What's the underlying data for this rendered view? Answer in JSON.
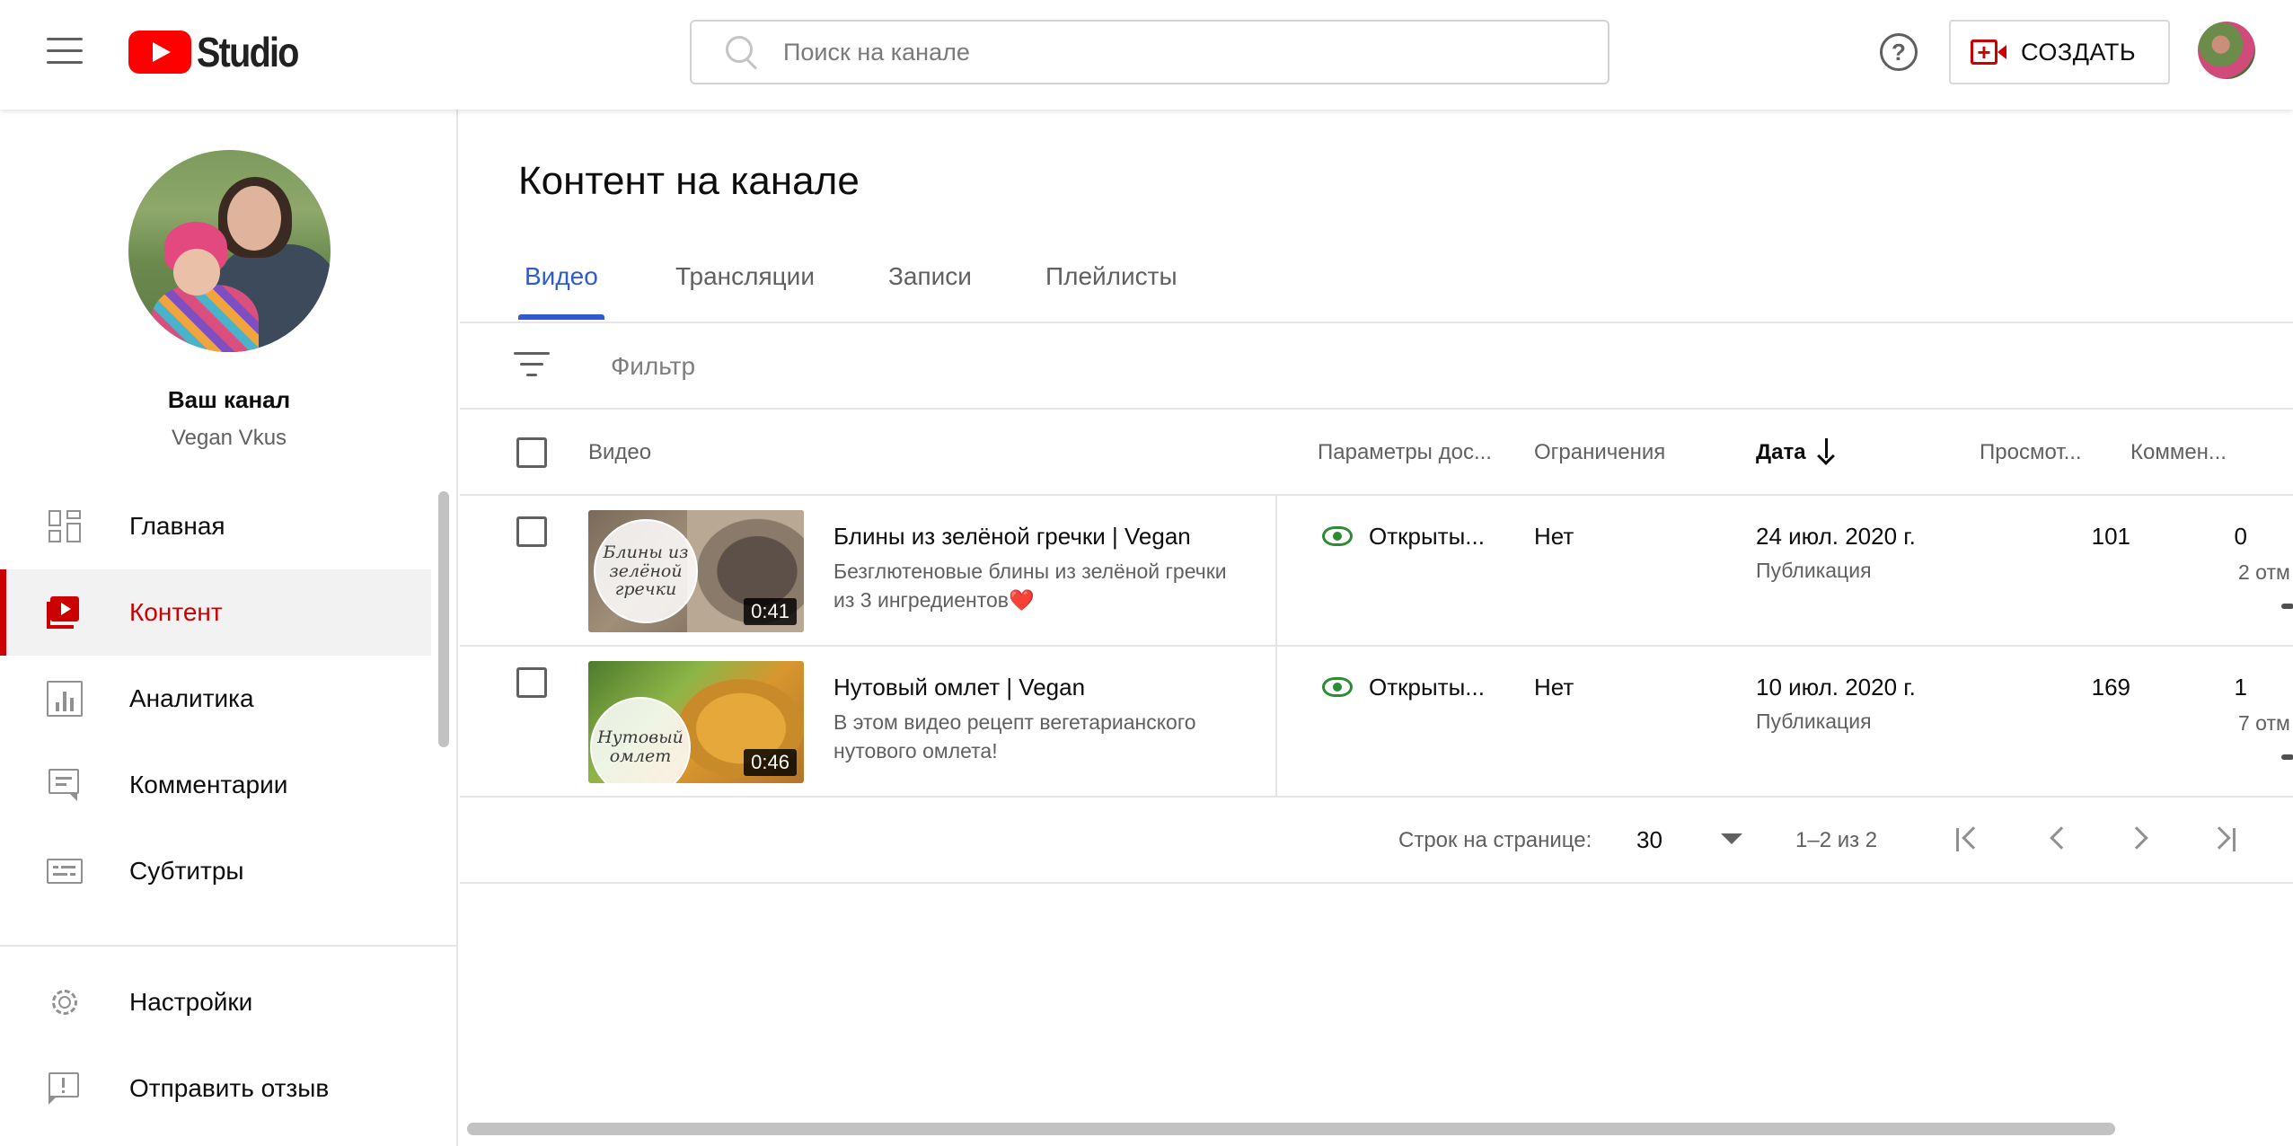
{
  "header": {
    "logo_text": "Studio",
    "search_placeholder": "Поиск на канале",
    "help_label": "?",
    "create_label": "СОЗДАТЬ"
  },
  "sidebar": {
    "channel_title": "Ваш канал",
    "channel_name": "Vegan Vkus",
    "items": [
      {
        "label": "Главная",
        "icon": "dashboard-icon",
        "active": false
      },
      {
        "label": "Контент",
        "icon": "content-icon",
        "active": true
      },
      {
        "label": "Аналитика",
        "icon": "analytics-icon",
        "active": false
      },
      {
        "label": "Комментарии",
        "icon": "comments-icon",
        "active": false
      },
      {
        "label": "Субтитры",
        "icon": "subtitles-icon",
        "active": false
      }
    ],
    "bottom_items": [
      {
        "label": "Настройки",
        "icon": "gear-icon"
      },
      {
        "label": "Отправить отзыв",
        "icon": "feedback-icon"
      }
    ]
  },
  "main": {
    "title": "Контент на канале",
    "tabs": [
      {
        "label": "Видео",
        "active": true
      },
      {
        "label": "Трансляции",
        "active": false
      },
      {
        "label": "Записи",
        "active": false
      },
      {
        "label": "Плейлисты",
        "active": false
      }
    ],
    "filter_placeholder": "Фильтр",
    "columns": [
      "Видео",
      "Параметры дос...",
      "Ограничения",
      "Дата",
      "Просмот...",
      "Коммен..."
    ],
    "sort_column": "Дата",
    "rows": [
      {
        "title": "Блины из зелёной гречки | Vegan",
        "description": "Безглютеновые блины из зелёной гречки из 3 ингредиентов❤️",
        "thumb_text": "Блины из зелёной гречки",
        "duration": "0:41",
        "visibility": "Открыты...",
        "restrictions": "Нет",
        "date": "24 июл. 2020 г.",
        "date_status": "Публикация",
        "views": "101",
        "comments": "0",
        "likes_partial": "2 отм"
      },
      {
        "title": "Нутовый омлет | Vegan",
        "description": "В этом видео рецепт вегетарианского нутового омлета!",
        "thumb_text": "Нутовый омлет",
        "duration": "0:46",
        "visibility": "Открыты...",
        "restrictions": "Нет",
        "date": "10 июл. 2020 г.",
        "date_status": "Публикация",
        "views": "169",
        "comments": "1",
        "likes_partial": "7 отм"
      }
    ],
    "pagination": {
      "rows_label": "Строк на странице:",
      "rows_value": "30",
      "range": "1–2 из 2"
    }
  },
  "colors": {
    "accent_red": "#cc0000",
    "tab_blue": "#2f5bd0",
    "visible_green": "#2d8a35"
  }
}
